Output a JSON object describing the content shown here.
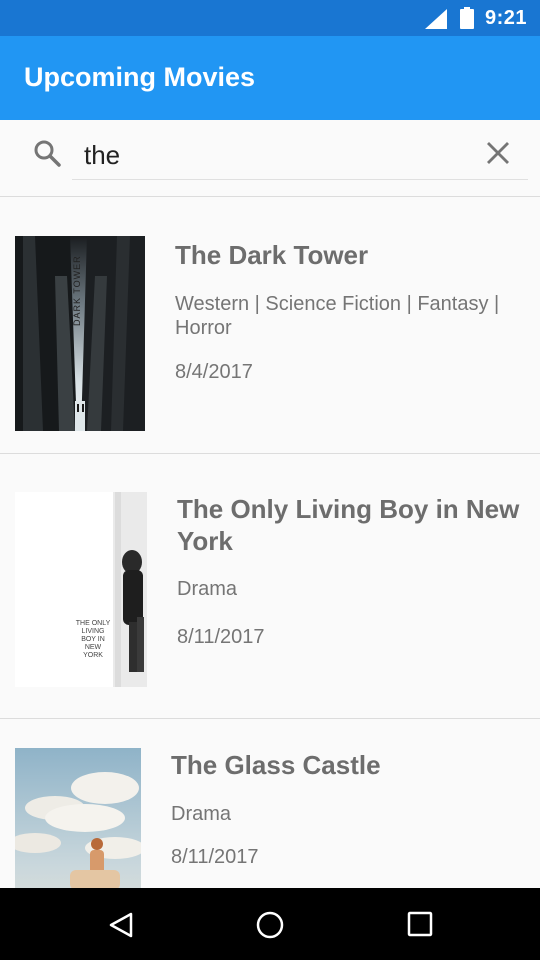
{
  "status_bar": {
    "time": "9:21",
    "icons": [
      "signal-icon",
      "battery-icon"
    ]
  },
  "app_bar": {
    "title": "Upcoming Movies"
  },
  "search": {
    "value": "the",
    "icons": [
      "search-icon",
      "close-icon"
    ]
  },
  "movies": [
    {
      "title": "The Dark Tower",
      "genres": "Western | Science Fiction | Fantasy | Horror",
      "date": "8/4/2017",
      "poster_text": "DARK TOWER"
    },
    {
      "title": "The Only Living Boy in New York",
      "genres": "Drama",
      "date": "8/11/2017",
      "poster_text": "THE ONLY LIVING BOY IN NEW YORK"
    },
    {
      "title": "The Glass Castle",
      "genres": "Drama",
      "date": "8/11/2017"
    }
  ],
  "nav_bar": {
    "icons": [
      "back-icon",
      "home-icon",
      "recents-icon"
    ]
  },
  "colors": {
    "status_bar": "#1976d2",
    "app_bar": "#2196f3",
    "background": "#fafafa",
    "title_text": "#6d6d6d",
    "secondary_text": "#757575"
  }
}
